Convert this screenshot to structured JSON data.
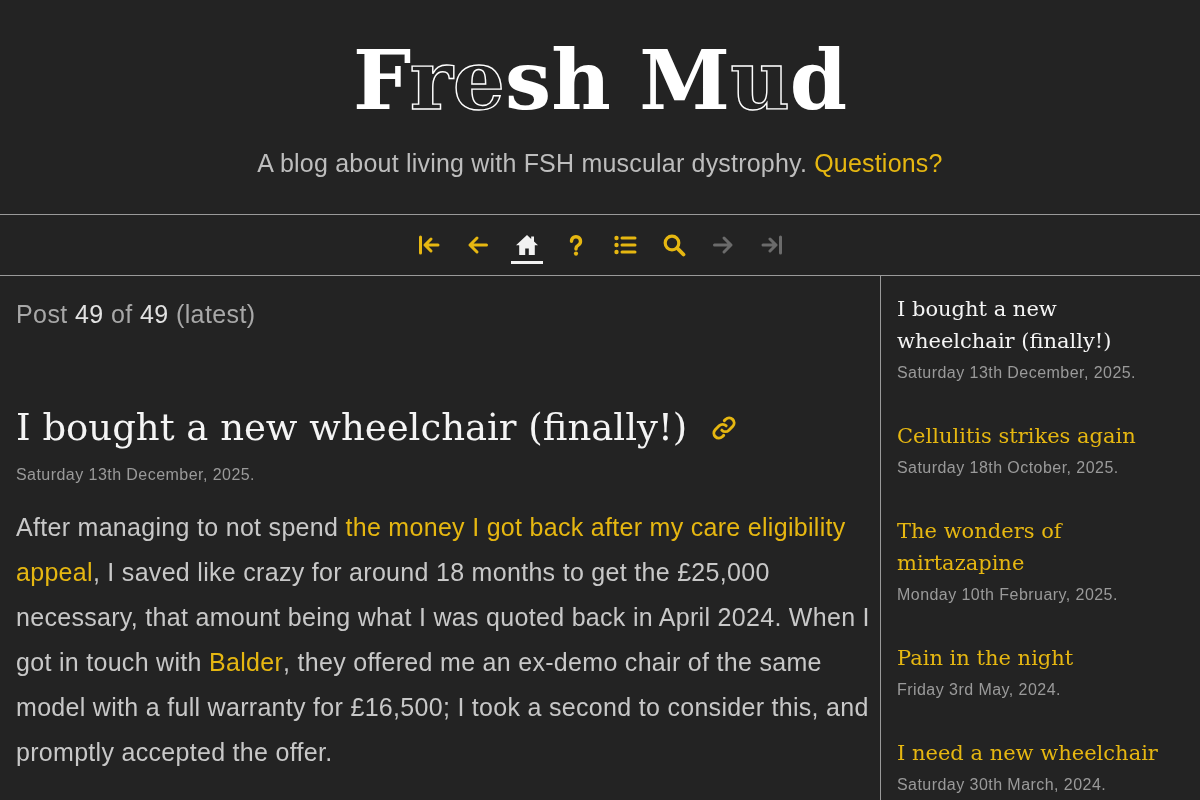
{
  "header": {
    "title": [
      {
        "text": "F",
        "outlined": false
      },
      {
        "text": "re",
        "outlined": true
      },
      {
        "text": "sh M",
        "outlined": false
      },
      {
        "text": "u",
        "outlined": true
      },
      {
        "text": "d",
        "outlined": false
      }
    ],
    "tagline": "A blog about living with FSH muscular dystrophy.",
    "tagline_link": "Questions?"
  },
  "nav": [
    {
      "kind": "first",
      "selected": false,
      "disabled": false
    },
    {
      "kind": "previous",
      "selected": false,
      "disabled": false
    },
    {
      "kind": "home",
      "selected": true,
      "disabled": false
    },
    {
      "kind": "help",
      "selected": false,
      "disabled": false
    },
    {
      "kind": "list",
      "selected": false,
      "disabled": false
    },
    {
      "kind": "search",
      "selected": false,
      "disabled": false
    },
    {
      "kind": "next",
      "selected": false,
      "disabled": true
    },
    {
      "kind": "last",
      "selected": false,
      "disabled": true
    }
  ],
  "post": {
    "counter": {
      "label": "Post",
      "current": "49",
      "separator": "of",
      "total": "49",
      "note": "(latest)"
    },
    "title": "I bought a new wheelchair (finally!)",
    "date": "Saturday 13th December, 2025.",
    "body": [
      {
        "kind": "text",
        "text": "After managing to not spend "
      },
      {
        "kind": "link",
        "text": "the money I got back after my care eligibility "
      },
      {
        "kind": "link",
        "text": "appeal"
      },
      {
        "kind": "text",
        "text": ", I saved like crazy for around 18 months to get the £25,000 necessary, that amount being what I was quoted back in April 2024. When I got in touch with "
      },
      {
        "kind": "link",
        "text": "Balder"
      },
      {
        "kind": "text",
        "text": ", they offered me an ex-demo chair of the same model with a full warranty for £16,500; I took a second to consider this, and promptly accepted the offer."
      }
    ]
  },
  "sidebar": {
    "posts": [
      {
        "title": "I bought a new wheelchair (finally!)",
        "date": "Saturday 13th December, 2025.",
        "selected": true
      },
      {
        "title": "Cellulitis strikes again",
        "date": "Saturday 18th October, 2025.",
        "selected": false
      },
      {
        "title": "The wonders of mirtazapine",
        "date": "Monday 10th February, 2025.",
        "selected": false
      },
      {
        "title": "Pain in the night",
        "date": "Friday 3rd May, 2024.",
        "selected": false
      },
      {
        "title": "I need a new wheelchair",
        "date": "Saturday 30th March, 2024.",
        "selected": false
      }
    ]
  }
}
